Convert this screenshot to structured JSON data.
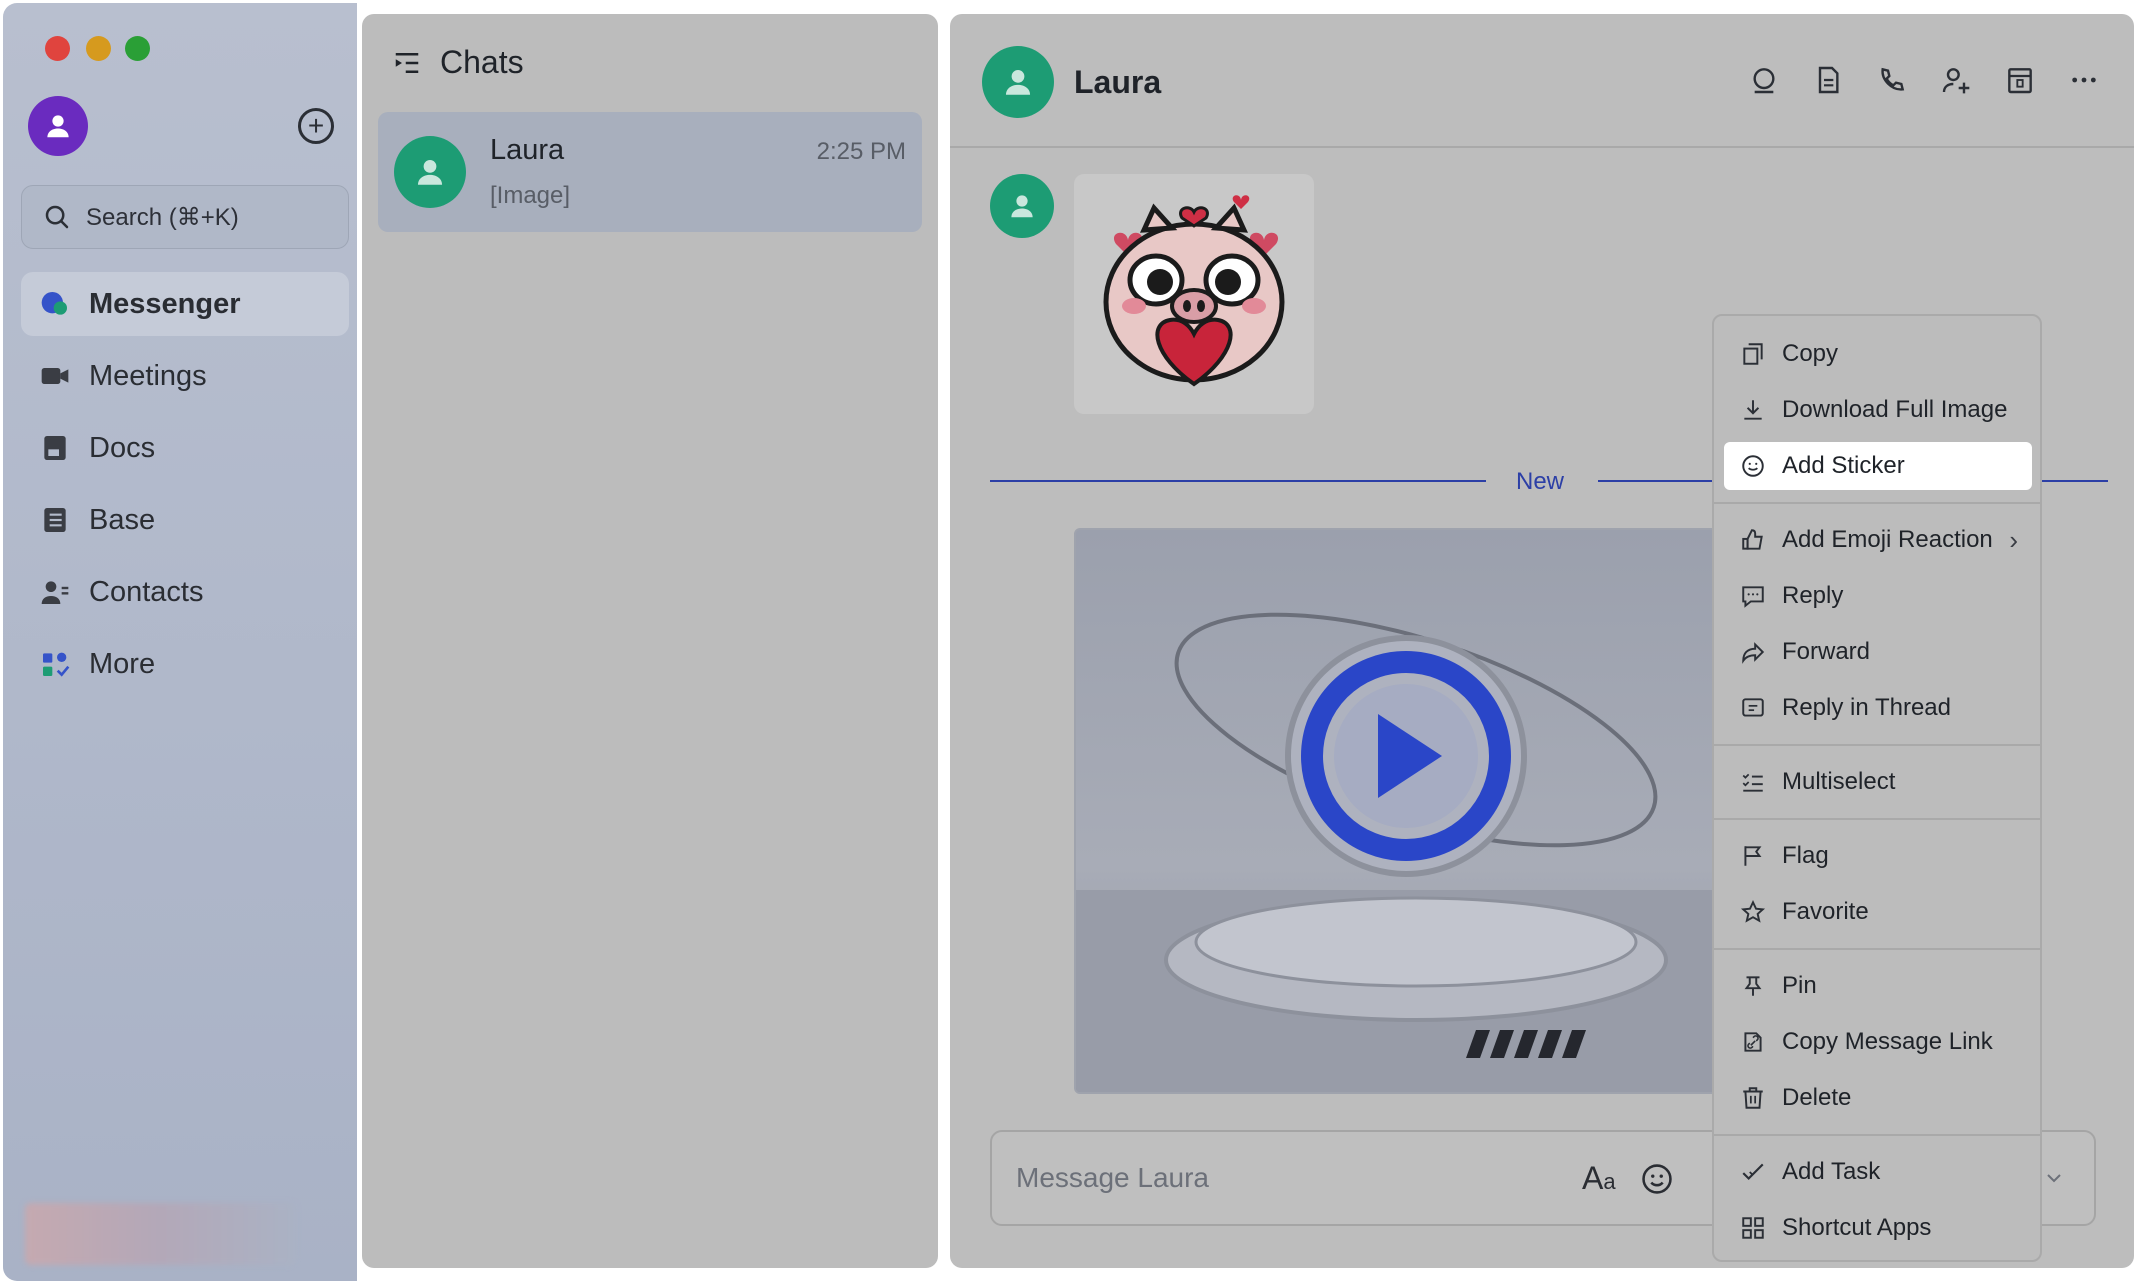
{
  "sidebar": {
    "search_placeholder": "Search (⌘+K)",
    "nav": [
      {
        "label": "Messenger",
        "icon": "messenger-icon",
        "active": true
      },
      {
        "label": "Meetings",
        "icon": "video-camera-icon"
      },
      {
        "label": "Docs",
        "icon": "docs-icon"
      },
      {
        "label": "Base",
        "icon": "base-icon"
      },
      {
        "label": "Contacts",
        "icon": "contacts-icon"
      },
      {
        "label": "More",
        "icon": "more-apps-icon"
      }
    ]
  },
  "chats": {
    "title": "Chats",
    "items": [
      {
        "name": "Laura",
        "preview": "[Image]",
        "time": "2:25 PM"
      }
    ]
  },
  "conversation": {
    "name": "Laura",
    "new_divider": "New",
    "composer_placeholder": "Message Laura",
    "header_icons": [
      "search-chat-icon",
      "doc-icon",
      "call-icon",
      "add-member-icon",
      "calendar-icon",
      "more-icon"
    ]
  },
  "context_menu": {
    "items": [
      {
        "label": "Copy",
        "icon": "copy-icon"
      },
      {
        "label": "Download Full Image",
        "icon": "download-icon"
      },
      {
        "label": "Add Sticker",
        "icon": "sticker-icon",
        "highlighted": true
      },
      {
        "label": "Add Emoji Reaction",
        "icon": "thumbs-up-icon",
        "submenu": true
      },
      {
        "label": "Reply",
        "icon": "reply-icon"
      },
      {
        "label": "Forward",
        "icon": "forward-icon"
      },
      {
        "label": "Reply in Thread",
        "icon": "thread-icon"
      },
      {
        "label": "Multiselect",
        "icon": "multiselect-icon"
      },
      {
        "label": "Flag",
        "icon": "flag-icon"
      },
      {
        "label": "Favorite",
        "icon": "star-icon"
      },
      {
        "label": "Pin",
        "icon": "pin-icon"
      },
      {
        "label": "Copy Message Link",
        "icon": "link-icon"
      },
      {
        "label": "Delete",
        "icon": "trash-icon"
      },
      {
        "label": "Add Task",
        "icon": "task-icon"
      },
      {
        "label": "Shortcut Apps",
        "icon": "apps-grid-icon"
      }
    ]
  },
  "colors": {
    "avatar_green": "#1d9c74",
    "me_avatar_purple": "#6a2bbf",
    "accent_blue": "#2c3fa6"
  }
}
